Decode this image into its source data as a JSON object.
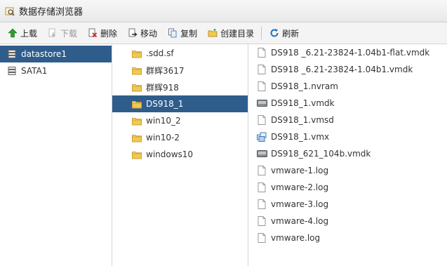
{
  "window": {
    "title": "数据存储浏览器"
  },
  "toolbar": {
    "upload": "上载",
    "download": "下载",
    "delete": "删除",
    "move": "移动",
    "copy": "复制",
    "mkdir": "创建目录",
    "refresh": "刷新"
  },
  "datastores": [
    {
      "label": "datastore1",
      "selected": true
    },
    {
      "label": "SATA1",
      "selected": false
    }
  ],
  "folders": [
    {
      "label": ".sdd.sf"
    },
    {
      "label": "群辉3617"
    },
    {
      "label": "群辉918"
    },
    {
      "label": "DS918_1",
      "selected": true
    },
    {
      "label": "win10_2"
    },
    {
      "label": "win10-2"
    },
    {
      "label": "windows10"
    }
  ],
  "files": [
    {
      "label": "DS918 _6.21-23824-1.04b1-flat.vmdk",
      "icon": "file-icon"
    },
    {
      "label": "DS918 _6.21-23824-1.04b1.vmdk",
      "icon": "file-icon"
    },
    {
      "label": "DS918_1.nvram",
      "icon": "file-icon"
    },
    {
      "label": "DS918_1.vmdk",
      "icon": "disk-icon"
    },
    {
      "label": "DS918_1.vmsd",
      "icon": "file-icon"
    },
    {
      "label": "DS918_1.vmx",
      "icon": "vm-icon"
    },
    {
      "label": "DS918_621_104b.vmdk",
      "icon": "disk-icon"
    },
    {
      "label": "vmware-1.log",
      "icon": "file-icon"
    },
    {
      "label": "vmware-2.log",
      "icon": "file-icon"
    },
    {
      "label": "vmware-3.log",
      "icon": "file-icon"
    },
    {
      "label": "vmware-4.log",
      "icon": "file-icon"
    },
    {
      "label": "vmware.log",
      "icon": "file-icon"
    }
  ],
  "colors": {
    "selection": "#2e5d8c",
    "folder": "#f2c94c",
    "refresh": "#1f6fc5",
    "upload": "#2e9c2e"
  }
}
